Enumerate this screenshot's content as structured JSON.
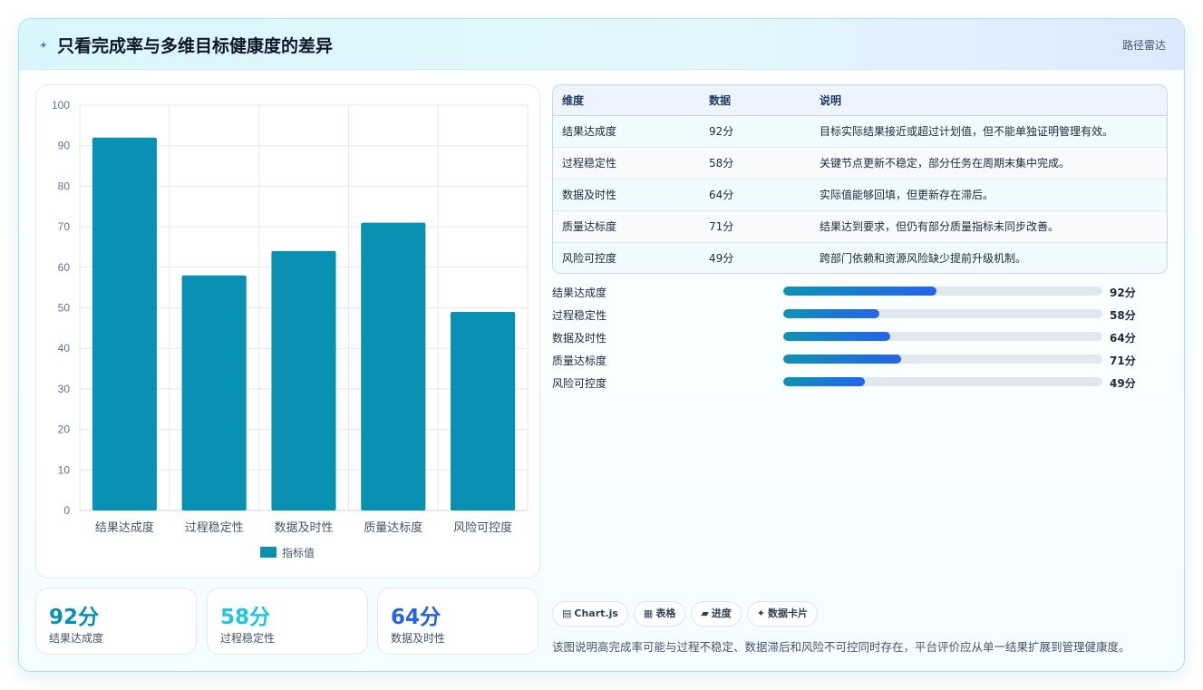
{
  "header": {
    "title": "只看完成率与多维目标健康度的差异",
    "tag": "路径雷达",
    "icon": "bolt-icon"
  },
  "colors": {
    "bar": "#0891b2",
    "stat_1": "#0891b2",
    "stat_2": "#22c5de",
    "stat_3": "#2563eb",
    "progress_start": "#0e93b3",
    "progress_end": "#2563eb"
  },
  "chart_data": {
    "type": "bar",
    "categories": [
      "结果达成度",
      "过程稳定性",
      "数据及时性",
      "质量达标度",
      "风险可控度"
    ],
    "series": [
      {
        "name": "指标值",
        "values": [
          92,
          58,
          64,
          71,
          49
        ]
      }
    ],
    "ylim": [
      0,
      100
    ],
    "yticks": [
      0,
      10,
      20,
      30,
      40,
      50,
      60,
      70,
      80,
      90,
      100
    ],
    "grid": true,
    "legend": "bottom"
  },
  "stats": [
    {
      "value": "92分",
      "label": "结果达成度"
    },
    {
      "value": "58分",
      "label": "过程稳定性"
    },
    {
      "value": "64分",
      "label": "数据及时性"
    }
  ],
  "table": {
    "headers": [
      "维度",
      "数据",
      "说明"
    ],
    "rows": [
      [
        "结果达成度",
        "92分",
        "目标实际结果接近或超过计划值，但不能单独证明管理有效。"
      ],
      [
        "过程稳定性",
        "58分",
        "关键节点更新不稳定，部分任务在周期末集中完成。"
      ],
      [
        "数据及时性",
        "64分",
        "实际值能够回填，但更新存在滞后。"
      ],
      [
        "质量达标度",
        "71分",
        "结果达到要求，但仍有部分质量指标未同步改善。"
      ],
      [
        "风险可控度",
        "49分",
        "跨部门依赖和资源风险缺少提前升级机制。"
      ]
    ]
  },
  "progress": {
    "max": 100,
    "items": [
      {
        "label": "结果达成度",
        "value": 92,
        "value_text": "92分",
        "fill_percent": 48
      },
      {
        "label": "过程稳定性",
        "value": 58,
        "value_text": "58分",
        "fill_percent": 30
      },
      {
        "label": "数据及时性",
        "value": 64,
        "value_text": "64分",
        "fill_percent": 33.5
      },
      {
        "label": "质量达标度",
        "value": 71,
        "value_text": "71分",
        "fill_percent": 37
      },
      {
        "label": "风险可控度",
        "value": 49,
        "value_text": "49分",
        "fill_percent": 25.5
      }
    ]
  },
  "chips": [
    {
      "icon": "▤",
      "icon_name": "chart-icon",
      "label": "Chart.js"
    },
    {
      "icon": "▦",
      "icon_name": "table-icon",
      "label": "表格"
    },
    {
      "icon": "▰",
      "icon_name": "progress-icon",
      "label": "进度"
    },
    {
      "icon": "✦",
      "icon_name": "sparkle-icon",
      "label": "数据卡片"
    }
  ],
  "note": "该图说明高完成率可能与过程不稳定、数据滞后和风险不可控同时存在，平台评价应从单一结果扩展到管理健康度。"
}
